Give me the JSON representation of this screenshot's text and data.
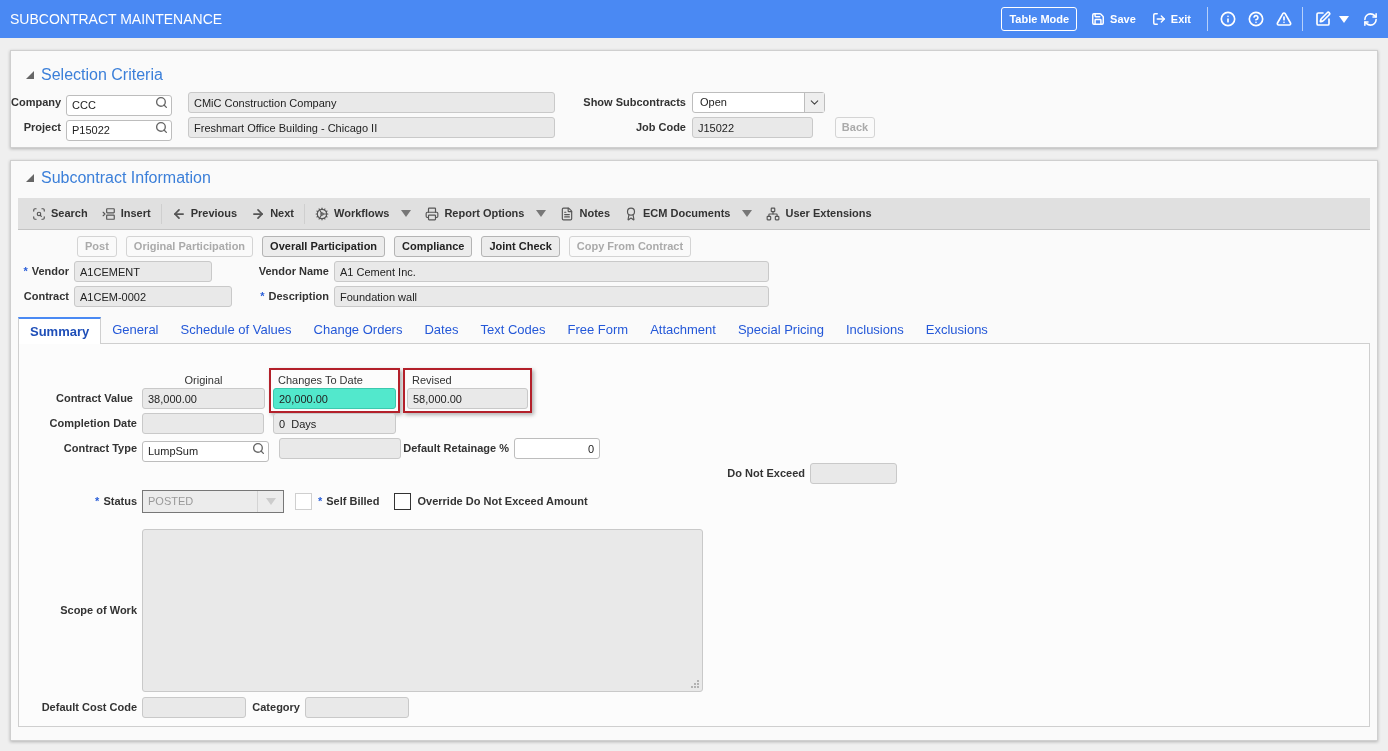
{
  "header": {
    "title": "SUBCONTRACT MAINTENANCE",
    "buttons": [
      {
        "kind": "outlined",
        "label": "Table Mode"
      },
      {
        "kind": "save",
        "label": "Save"
      },
      {
        "kind": "exit",
        "label": "Exit"
      }
    ]
  },
  "selection_criteria": {
    "title": "Selection Criteria",
    "expanded": true,
    "company": {
      "label": "Company",
      "value": "CCC",
      "name": "CMiC Construction Company"
    },
    "project": {
      "label": "Project",
      "value": "P15022",
      "name": "Freshmart Office Building - Chicago II"
    },
    "show_subcontracts": {
      "label": "Show Subcontracts",
      "value": "Open"
    },
    "job_code": {
      "label": "Job Code",
      "value": "J15022"
    },
    "back_button": {
      "label": "Back",
      "disabled": true
    }
  },
  "subcontract_information": {
    "title": "Subcontract Information",
    "expanded": true,
    "toolbar": [
      {
        "label": "Search",
        "has_menu": false,
        "separator_after": false
      },
      {
        "label": "Insert",
        "has_menu": false,
        "separator_after": true
      },
      {
        "label": "Previous",
        "has_menu": false,
        "separator_after": false
      },
      {
        "label": "Next",
        "has_menu": false,
        "separator_after": true
      },
      {
        "label": "Workflows",
        "has_menu": true,
        "separator_after": false
      },
      {
        "label": "Report Options",
        "has_menu": true,
        "separator_after": false
      },
      {
        "label": "Notes",
        "has_menu": false,
        "separator_after": false
      },
      {
        "label": "ECM Documents",
        "has_menu": true,
        "separator_after": false
      },
      {
        "label": "User Extensions",
        "has_menu": false,
        "separator_after": false
      }
    ],
    "actions": [
      {
        "label": "Post",
        "disabled": true
      },
      {
        "label": "Original Participation",
        "disabled": true
      },
      {
        "label": "Overall Participation",
        "disabled": false
      },
      {
        "label": "Compliance",
        "disabled": false
      },
      {
        "label": "Joint Check",
        "disabled": false
      },
      {
        "label": "Copy From Contract",
        "disabled": true
      }
    ],
    "vendor": {
      "label": "Vendor",
      "required_mark": "*",
      "value": "A1CEMENT"
    },
    "vendor_name": {
      "label": "Vendor Name",
      "value": "A1 Cement Inc."
    },
    "contract": {
      "label": "Contract",
      "value": "A1CEM-0002"
    },
    "description": {
      "label": "Description",
      "required_mark": "*",
      "value": "Foundation wall"
    },
    "tabs": [
      {
        "label": "Summary",
        "selected": true
      },
      {
        "label": "General",
        "selected": false
      },
      {
        "label": "Schedule of Values",
        "selected": false
      },
      {
        "label": "Change Orders",
        "selected": false
      },
      {
        "label": "Dates",
        "selected": false
      },
      {
        "label": "Text Codes",
        "selected": false
      },
      {
        "label": "Free Form",
        "selected": false
      },
      {
        "label": "Attachment",
        "selected": false
      },
      {
        "label": "Special Pricing",
        "selected": false
      },
      {
        "label": "Inclusions",
        "selected": false
      },
      {
        "label": "Exclusions",
        "selected": false
      }
    ],
    "summary": {
      "contract_value": {
        "label": "Contract Value",
        "columns": [
          {
            "header": "Original",
            "value": "38,000.00",
            "marked": false,
            "highlighted": false
          },
          {
            "header": "Changes To Date",
            "value": "20,000.00",
            "marked": true,
            "highlighted": true
          },
          {
            "header": "Revised",
            "value": "58,000.00",
            "marked": true,
            "highlighted": false
          }
        ]
      },
      "completion_date": {
        "label": "Completion Date",
        "duration": "0  Days"
      },
      "contract_type": {
        "label": "Contract Type",
        "value": "LumpSum"
      },
      "default_retainage": {
        "label": "Default Retainage %",
        "value": "0"
      },
      "do_not_exceed": {
        "label": "Do Not Exceed"
      },
      "status": {
        "label": "Status",
        "required_mark": "*",
        "value": "POSTED",
        "disabled": true
      },
      "checkboxes": [
        {
          "label": "Self Billed",
          "required_mark": "*",
          "checked": false,
          "disabled": true
        },
        {
          "label": "Override Do Not Exceed Amount",
          "checked": false,
          "disabled": false
        }
      ],
      "scope_of_work": {
        "label": "Scope of Work"
      },
      "default_cost_code": {
        "label": "Default Cost Code"
      },
      "category": {
        "label": "Category"
      }
    }
  }
}
